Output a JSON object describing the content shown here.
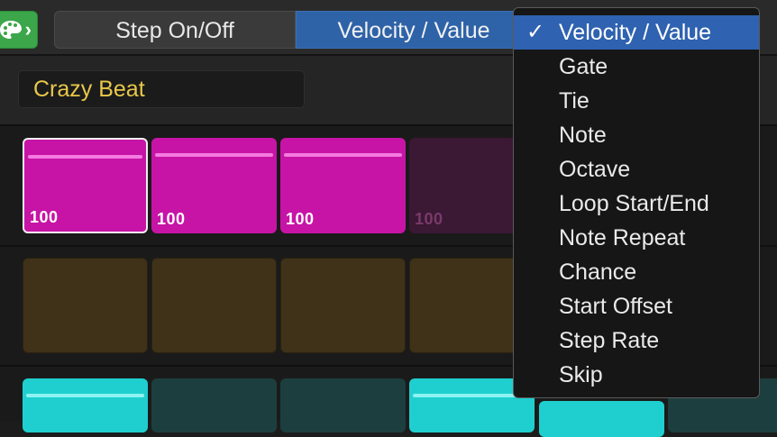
{
  "toolbar": {
    "palette_icon": "palette-icon",
    "arrow_glyph": "›",
    "tabs": [
      {
        "label": "Step On/Off"
      },
      {
        "label": "Velocity / Value"
      }
    ]
  },
  "pattern": {
    "name": "Crazy Beat"
  },
  "rows": [
    {
      "color": "#c714a6",
      "steps": [
        {
          "value": "100"
        },
        {
          "value": "100"
        },
        {
          "value": "100"
        },
        {
          "value": "100"
        }
      ]
    },
    {
      "color": "#3f3219"
    },
    {
      "color": "#1fcfcf"
    }
  ],
  "menu": {
    "selected_check": "✓",
    "items": [
      {
        "label": "Velocity / Value"
      },
      {
        "label": "Gate"
      },
      {
        "label": "Tie"
      },
      {
        "label": "Note"
      },
      {
        "label": "Octave"
      },
      {
        "label": "Loop Start/End"
      },
      {
        "label": "Note Repeat"
      },
      {
        "label": "Chance"
      },
      {
        "label": "Start Offset"
      },
      {
        "label": "Step Rate"
      },
      {
        "label": "Skip"
      }
    ]
  }
}
